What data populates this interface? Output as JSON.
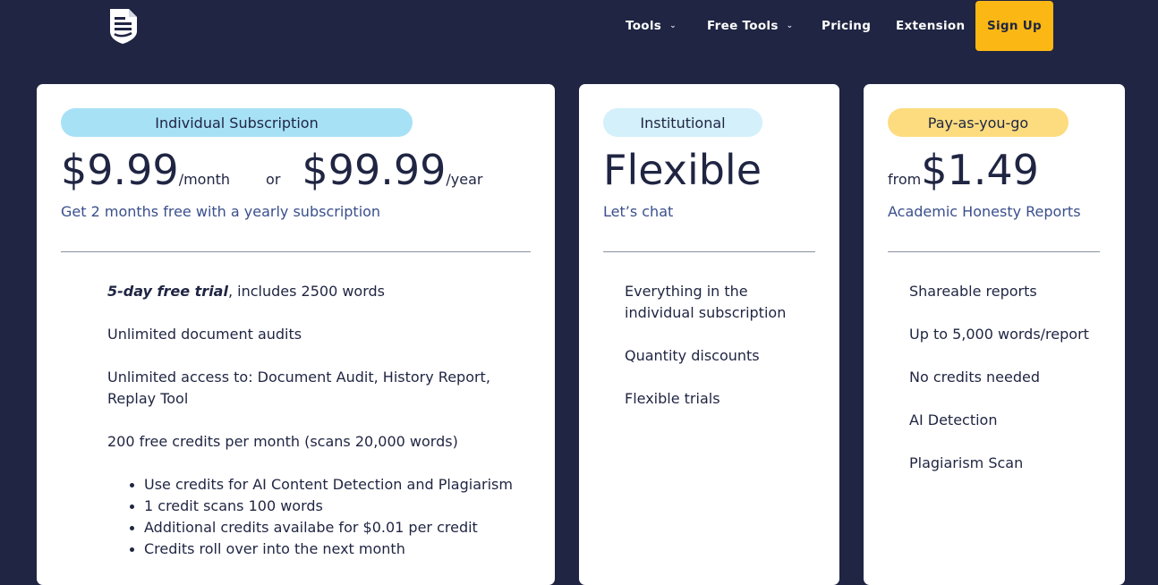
{
  "nav": {
    "tools": "Tools",
    "free_tools": "Free Tools",
    "pricing": "Pricing",
    "extension": "Extension",
    "sign_up": "Sign Up"
  },
  "colors": {
    "background": "#1f2542",
    "accent": "#fbb714",
    "pill_individual": "#a7e1f6",
    "pill_institutional": "#d3f0fb",
    "pill_payg": "#fcdc7f",
    "link_text": "#3a4f8c"
  },
  "icons": {
    "logo": "document-shield-icon",
    "dropdown": "chevron-down-icon"
  },
  "cards": {
    "individual": {
      "tag": "Individual Subscription",
      "monthly_price": "$9.99",
      "monthly_unit": "/month",
      "or": "or",
      "yearly_price": "$99.99",
      "yearly_unit": "/year",
      "note": "Get 2 months free with a yearly subscription",
      "trial_bold": "5-day free trial",
      "trial_rest": ", includes 2500 words",
      "features": [
        "Unlimited document audits",
        "Unlimited access to: Document Audit, History Report, Replay Tool",
        "200 free credits per month (scans 20,000 words)"
      ],
      "bullets": [
        "Use credits for AI Content Detection and Plagiarism",
        "1 credit scans 100 words",
        "Additional credits availabe for $0.01 per credit",
        "Credits roll over into the next month"
      ]
    },
    "institutional": {
      "tag": "Institutional",
      "price": "Flexible",
      "note": "Let’s chat",
      "features": [
        "Everything in the individual subscription",
        "Quantity discounts",
        "Flexible trials"
      ]
    },
    "payg": {
      "tag": "Pay-as-you-go",
      "from": "from",
      "price": "$1.49",
      "note": "Academic Honesty Reports",
      "features": [
        "Shareable reports",
        "Up to 5,000 words/report",
        "No credits needed",
        "AI Detection",
        "Plagiarism Scan"
      ]
    }
  }
}
